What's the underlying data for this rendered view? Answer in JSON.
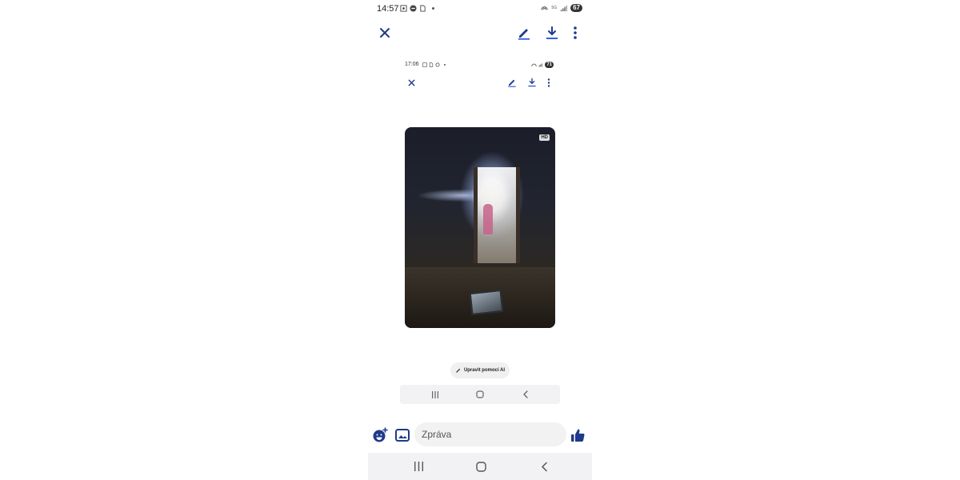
{
  "status_bar": {
    "time": "14:57",
    "battery": "67",
    "network": "5G"
  },
  "toolbar": {
    "close_icon": "close-icon",
    "edit_icon": "edit-icon",
    "download_icon": "download-icon",
    "more_icon": "more-vert-icon"
  },
  "screenshot": {
    "status_bar": {
      "time": "17:06",
      "battery": "71"
    },
    "video": {
      "quality_badge": "HD"
    },
    "ai_button": {
      "label": "Upravit pomocí AI"
    }
  },
  "composer": {
    "placeholder": "Zpráva"
  },
  "colors": {
    "accent": "#1a4fd8",
    "icon_dark": "#1e3a8a"
  }
}
